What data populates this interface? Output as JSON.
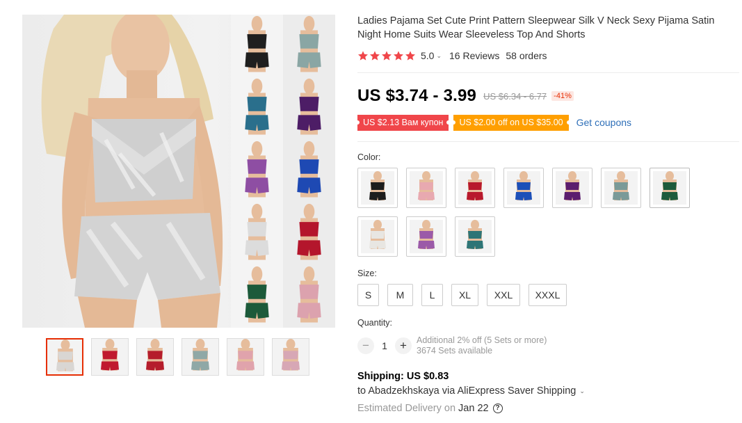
{
  "product": {
    "title": "Ladies Pajama Set Cute Print Pattern Sleepwear Silk V Neck Sexy Pijama Satin Night Home Suits Wear Sleeveless Top And Shorts",
    "rating": "5.0",
    "rating_stars": 5,
    "reviews": "16 Reviews",
    "orders": "58 orders"
  },
  "price": {
    "current": "US $3.74 - 3.99",
    "original": "US $6.34 - 6.77",
    "discount": "-41%"
  },
  "coupons": {
    "store_coupon": "US $2.13 Вам купон",
    "platform_coupon": "US $2.00 off on US $35.00",
    "get_coupons": "Get coupons"
  },
  "color": {
    "label": "Color:",
    "options": [
      {
        "color": "#1d1d1d"
      },
      {
        "color": "#e8a9b0"
      },
      {
        "color": "#b8192c"
      },
      {
        "color": "#1c4fb8"
      },
      {
        "color": "#5c1e6e"
      },
      {
        "color": "#7a9a98"
      },
      {
        "color": "#1d5b3c"
      },
      {
        "color": "#e8e6e2"
      },
      {
        "color": "#9b5aa8"
      },
      {
        "color": "#2e7576"
      }
    ]
  },
  "size": {
    "label": "Size:",
    "options": [
      "S",
      "M",
      "L",
      "XL",
      "XXL",
      "XXXL"
    ]
  },
  "quantity": {
    "label": "Quantity:",
    "value": "1",
    "minus": "−",
    "plus": "+",
    "bulk_note": "Additional 2% off (5 Sets or more)",
    "available": "3674 Sets available"
  },
  "shipping": {
    "title": "Shipping: US $0.83",
    "destination": "to Abadzekhskaya via AliExpress Saver Shipping",
    "delivery_label": "Estimated Delivery on",
    "delivery_date": "Jan 22"
  },
  "gallery": {
    "thumbnails": [
      {
        "color": "#d9d6d3",
        "active": true
      },
      {
        "color": "#c01a2f"
      },
      {
        "color": "#b51d2c"
      },
      {
        "color": "#8fa8a6"
      },
      {
        "color": "#e0a3ac"
      },
      {
        "color": "#d7a7b5"
      }
    ],
    "collage_colors": [
      "#1f1f1f",
      "#8aa6a4",
      "#2a6f8c",
      "#4d1d66",
      "#8e4ea3",
      "#1e49b3",
      "#dcdcdc",
      "#b4162c",
      "#1c5a3a",
      "#dca2ae"
    ]
  },
  "colors": {
    "accent_red": "#e62e04",
    "star": "#f0464a",
    "link_blue": "#2e6fb8",
    "coupon_red": "#f0464a",
    "coupon_orange": "#ff9f00"
  },
  "icons": {
    "star": "star-icon",
    "chevron": "chevron-down-icon",
    "help": "help-icon"
  }
}
